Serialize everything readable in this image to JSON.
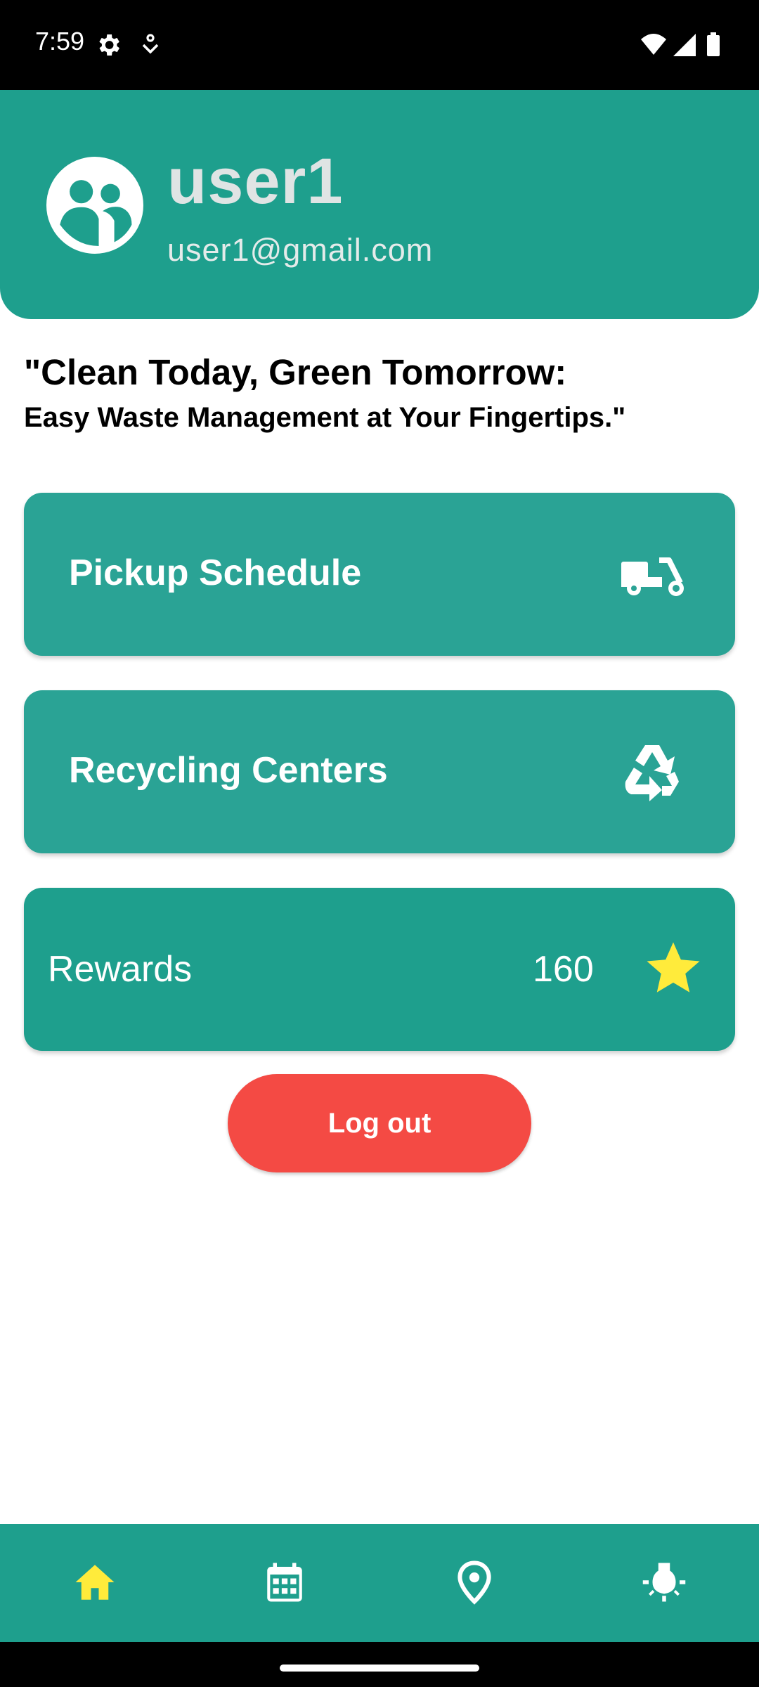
{
  "status": {
    "time": "7:59",
    "icons": [
      "gear-icon",
      "notification-icon",
      "wifi-icon",
      "signal-icon",
      "battery-icon"
    ]
  },
  "profile": {
    "username": "user1",
    "email": "user1@gmail.com",
    "avatar_icon": "group-avatar-icon"
  },
  "tagline": {
    "line1": "\"Clean Today, Green Tomorrow:",
    "line2": "Easy Waste Management at Your Fingertips.\""
  },
  "cards": {
    "pickup": {
      "label": "Pickup Schedule",
      "icon": "moped-icon"
    },
    "recycling": {
      "label": "Recycling Centers",
      "icon": "recycle-icon"
    },
    "rewards": {
      "label": "Rewards",
      "value": "160",
      "icon": "star-icon"
    }
  },
  "logout": {
    "label": "Log out"
  },
  "bottom_nav": {
    "items": [
      {
        "icon": "home-icon",
        "active": true
      },
      {
        "icon": "calendar-icon",
        "active": false
      },
      {
        "icon": "location-pin-icon",
        "active": false
      },
      {
        "icon": "lightbulb-icon",
        "active": false
      }
    ]
  },
  "colors": {
    "primary": "#1e9f8d",
    "card": "#2aa395",
    "logout": "#f44a44",
    "accent_yellow": "#ffeb3b"
  }
}
